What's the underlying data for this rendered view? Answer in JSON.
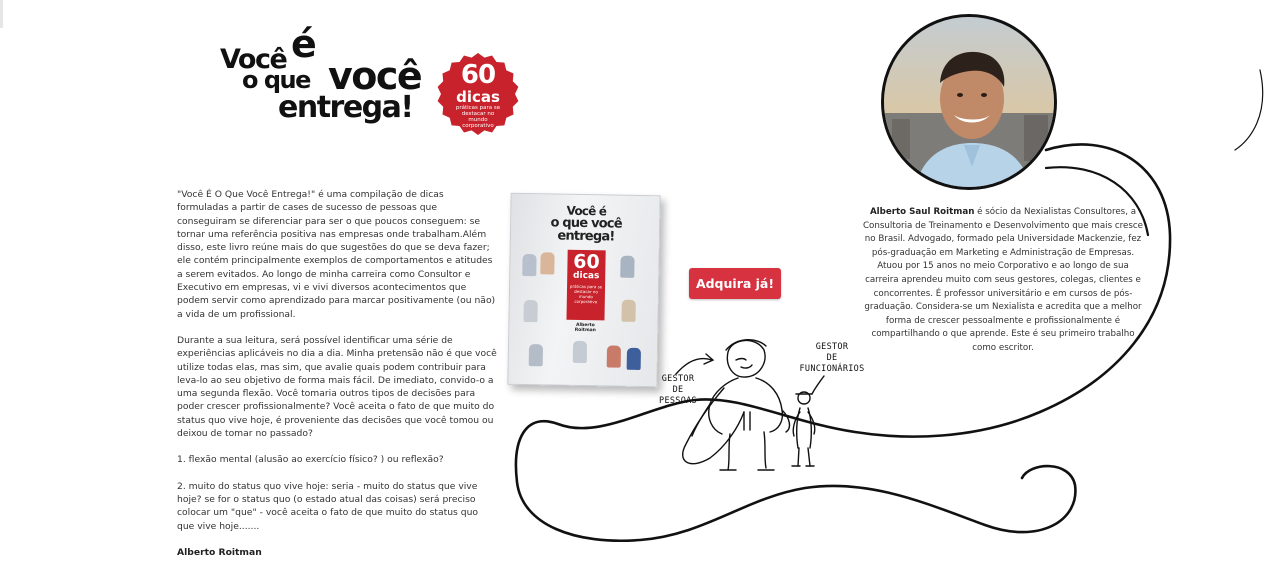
{
  "header": {
    "title_lines": [
      "Você",
      "é",
      "o que",
      "você",
      "entrega!"
    ],
    "seal": {
      "number": "60",
      "word": "dicas",
      "subtitle": "práticas para se destacar no mundo corporativo",
      "color": "#c8232c"
    }
  },
  "intro": {
    "paragraphs": [
      "\"Você É O Que Você Entrega!\" é uma compilação de dicas formuladas a partir de cases de sucesso de pessoas que conseguiram se diferenciar para ser o que poucos conseguem: se tornar uma referência positiva nas empresas onde trabalham.Além disso, este livro reúne mais do que sugestões do que se deva fazer; ele contém principalmente exemplos de comportamentos e atitudes a serem evitados. Ao longo de minha carreira como Consultor e Executivo em empresas, vi e vivi diversos acontecimentos que podem servir como aprendizado para marcar positivamente (ou não) a vida de um profissional.",
      "Durante a sua leitura, será possível identificar uma série de experiências aplicáveis no dia a dia. Minha pretensão não é que você utilize todas elas, mas sim, que avalie quais podem contribuir para leva-lo ao seu objetivo de forma mais fácil. De imediato, convido-o a uma segunda flexão. Você tomaria outros tipos de decisões para poder crescer profissionalmente? Você aceita o fato de que muito do status quo vive hoje, é proveniente das decisões que você tomou ou deixou de tomar no passado?",
      "1. flexão mental (alusão ao exercício físico? ) ou reflexão?",
      "2. muito do status quo vive hoje: seria - muito do status que vive hoje? se for o status quo (o estado atual das coisas) será preciso colocar um \"que\" - você aceita o fato de que muito do status quo que vive hoje......."
    ],
    "signature": "Alberto Roitman"
  },
  "book": {
    "title_line1": "Você é",
    "title_line2": "o que você",
    "title_line3": "entrega!",
    "number": "60",
    "word": "dicas",
    "subtitle": "práticas para se destacar no mundo corporativo",
    "author": "Alberto Roitman"
  },
  "cta": {
    "label": "Adquira já!",
    "color": "#d63240"
  },
  "illustration": {
    "label_left": [
      "GESTOR",
      "DE",
      "PESSOAS"
    ],
    "label_right": [
      "GESTOR",
      "DE",
      "FUNCIONÁRIOS"
    ]
  },
  "author": {
    "name": "Alberto Saul Roitman",
    "bio": " é sócio da Nexialistas Consultores, a Consultoria de Treinamento e Desenvolvimento que mais cresce no Brasil. Advogado, formado pela Universidade Mackenzie, fez pós-graduação em Marketing e Administração de Empresas. Atuou por 15 anos no meio Corporativo e ao longo de sua carreira aprendeu muito com seus gestores, colegas, clientes e concorrentes. É professor universitário e em cursos de pós-graduação. Considera-se um Nexialista e acredita que a melhor forma de crescer pessoalmente e profissionalmente é compartilhando o que aprende. Este é seu primeiro trabalho como escritor."
  }
}
